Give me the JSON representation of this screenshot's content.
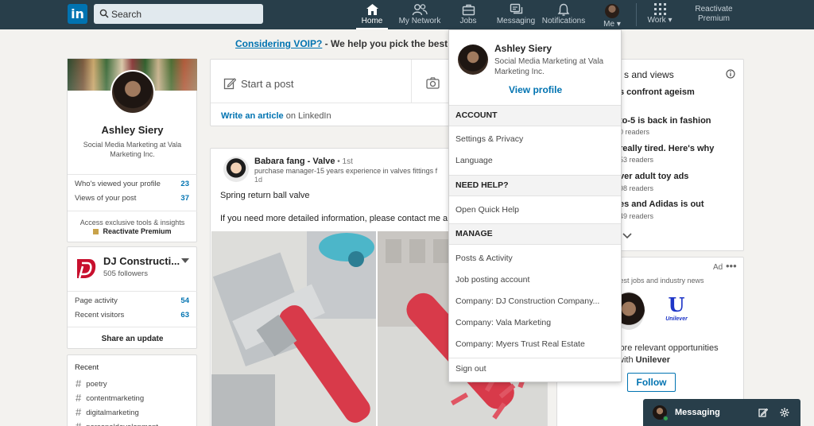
{
  "nav": {
    "logo": "in",
    "search_placeholder": "Search",
    "items": [
      {
        "label": "Home"
      },
      {
        "label": "My Network"
      },
      {
        "label": "Jobs"
      },
      {
        "label": "Messaging"
      },
      {
        "label": "Notifications"
      },
      {
        "label": "Me"
      },
      {
        "label": "Work"
      }
    ],
    "premium": "Reactivate Premium"
  },
  "promo": {
    "link": "Considering VOIP?",
    "rest": " - We help you pick the best VC"
  },
  "profile": {
    "name": "Ashley Siery",
    "headline": "Social Media Marketing at Vala Marketing Inc.",
    "stats": [
      {
        "label": "Who's viewed your profile",
        "value": "23"
      },
      {
        "label": "Views of your post",
        "value": "37"
      }
    ],
    "access_text": "Access exclusive tools & insights",
    "reactivate": "Reactivate Premium"
  },
  "company": {
    "name": "DJ Constructi...",
    "followers": "505 followers",
    "stats": [
      {
        "label": "Page activity",
        "value": "54"
      },
      {
        "label": "Recent visitors",
        "value": "63"
      }
    ],
    "share": "Share an update"
  },
  "recent": {
    "title": "Recent",
    "tags": [
      "poetry",
      "contentmarketing",
      "digitalmarketing",
      "personaldevelopment"
    ]
  },
  "share_box": {
    "start_post": "Start a post",
    "write_article": "Write an article",
    "on_linkedin": " on LinkedIn"
  },
  "post": {
    "author": "Babara fang - Valve",
    "degree": " • 1st",
    "headline": "purchase manager-15 years experience in valves fittings f",
    "time": "1d",
    "text1": "Spring return ball valve",
    "text2": "If you need more detailed information, please contact me a"
  },
  "news": {
    "title": "s and views",
    "items": [
      {
        "title": "s confront ageism",
        "sub": ""
      },
      {
        "title": "to-5 is back in fashion",
        "sub": "0 readers"
      },
      {
        "title": "really tired. Here's why",
        "sub": "53 readers"
      },
      {
        "title": "ver adult toy ads",
        "sub": "98 readers"
      },
      {
        "title": "es and Adidas is out",
        "sub": "49 readers"
      }
    ]
  },
  "ad": {
    "label": "Ad",
    "dots": "•••",
    "text1": "test jobs and industry news",
    "brand_mark": "U",
    "brand": "Unilever",
    "text2_line1": "lore relevant opportunities",
    "text2_line2": " with ",
    "text2_brand": "Unilever",
    "follow": "Follow"
  },
  "dropdown": {
    "name": "Ashley Siery",
    "headline": "Social Media Marketing at Vala Marketing Inc.",
    "view_profile": "View profile",
    "account_header": "ACCOUNT",
    "account_items": [
      "Settings & Privacy",
      "Language"
    ],
    "help_header": "NEED HELP?",
    "help_items": [
      "Open Quick Help"
    ],
    "manage_header": "MANAGE",
    "manage_items": [
      "Posts & Activity",
      "Job posting account",
      "Company: DJ Construction Company...",
      "Company: Vala Marketing",
      "Company: Myers Trust Real Estate"
    ],
    "sign_out": "Sign out"
  },
  "messaging": {
    "label": "Messaging"
  }
}
